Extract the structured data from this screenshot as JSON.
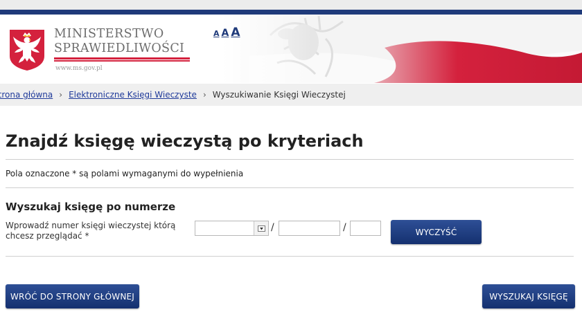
{
  "header": {
    "brand_line1": "MINISTERSTWO",
    "brand_line2": "SPRAWIEDLIWOŚCI",
    "brand_url": "www.ms.gov.pl",
    "font_size_small": "A",
    "font_size_medium": "A",
    "font_size_large": "A"
  },
  "breadcrumb": {
    "items": [
      "Strona główna",
      "Elektroniczne Księgi Wieczyste"
    ],
    "current": "Wyszukiwanie Księgi Wieczystej"
  },
  "page": {
    "title": "Znajdź księgę wieczystą po kryteriach",
    "required_note": "Pola oznaczone * są polami wymaganymi do wypełnienia"
  },
  "search_section": {
    "title": "Wyszukaj księgę po numerze",
    "field_label": "Wprowadź numer księgi wieczystej którą chcesz przeglądać *",
    "court_code_value": "",
    "number_value": "",
    "check_digit_value": "",
    "separator": "/",
    "clear_label": "WYCZYŚĆ"
  },
  "actions": {
    "back_label": "WRÓĆ DO STRONY GŁÓWNEJ",
    "search_label": "WYSZUKAJ KSIĘGĘ"
  },
  "colors": {
    "brand_navy": "#1f3a7a",
    "button_top": "#2e4f96",
    "button_bottom": "#14306f",
    "link": "#1f3a9a",
    "flag_red": "#d4213d"
  }
}
